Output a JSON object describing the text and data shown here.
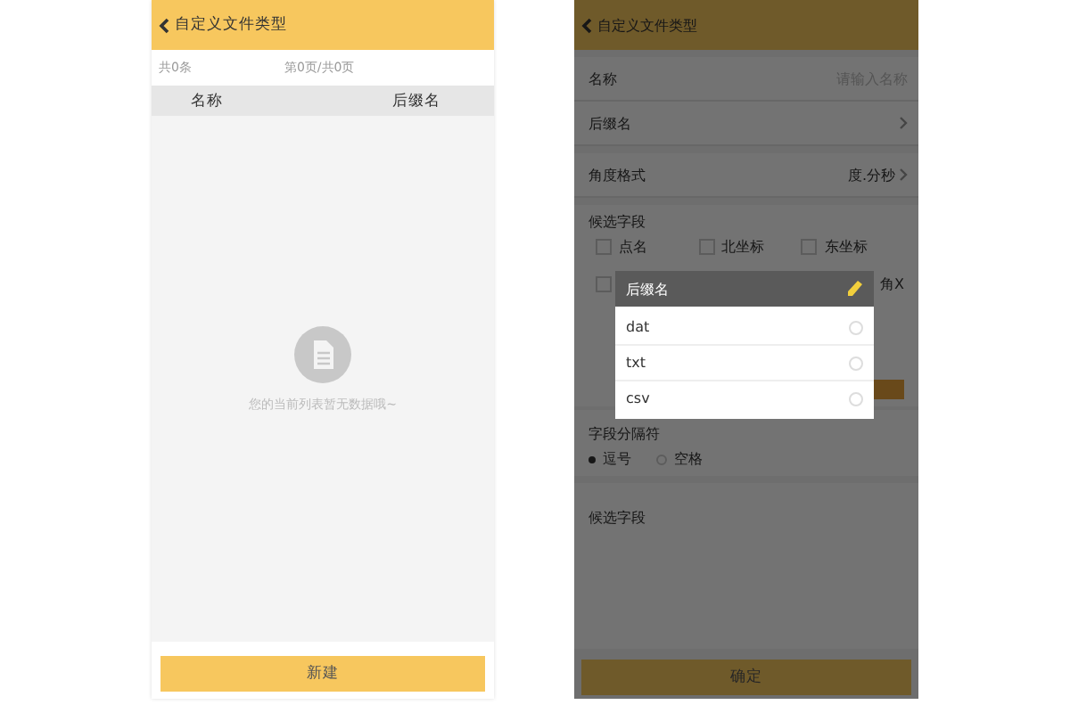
{
  "left_screen": {
    "header": {
      "title": "自定义文件类型"
    },
    "summary": {
      "count": "共0条",
      "pages": "第0页/共0页"
    },
    "table": {
      "columns": [
        "名称",
        "后缀名"
      ]
    },
    "empty_message": "您的当前列表暂无数据哦~",
    "new_button": "新建"
  },
  "right_screen": {
    "header": {
      "title": "自定义文件类型"
    },
    "form": {
      "name": {
        "label": "名称",
        "placeholder": "请输入名称"
      },
      "suffix": {
        "label": "后缀名"
      },
      "angle_format": {
        "label": "角度格式",
        "value": "度.分秒"
      },
      "candidate_fields": {
        "label": "候选字段",
        "items": [
          {
            "label": "点名",
            "checked": false
          },
          {
            "label": "北坐标",
            "checked": false
          },
          {
            "label": "东坐标",
            "checked": false
          },
          {
            "label": "角X",
            "checked": false
          }
        ]
      },
      "separator": {
        "label": "字段分隔符",
        "options": [
          {
            "label": "逗号",
            "selected": true
          },
          {
            "label": "空格",
            "selected": false
          }
        ]
      },
      "selected_fields": {
        "label": "候选字段"
      }
    },
    "confirm_button": "确定",
    "dialog": {
      "title": "后缀名",
      "options": [
        {
          "label": "dat",
          "selected": false
        },
        {
          "label": "txt",
          "selected": false
        },
        {
          "label": "csv",
          "selected": false
        }
      ]
    }
  }
}
